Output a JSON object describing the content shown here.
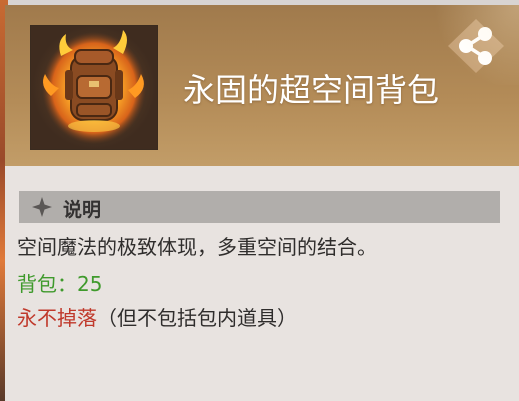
{
  "item": {
    "name": "永固的超空间背包",
    "icon": "backpack-icon"
  },
  "share": {
    "icon": "share-icon"
  },
  "section": {
    "icon": "diamond-star-icon",
    "title": "说明"
  },
  "description": {
    "main": "空间魔法的极致体现，多重空间的结合。",
    "capacity": "背包：25",
    "no_drop": "永不掉落",
    "no_drop_note": "（但不包括包内道具）"
  },
  "colors": {
    "capacity": "#3f9a2c",
    "no_drop": "#c0392b",
    "header": "#b48c58",
    "body": "#e8e3e0",
    "section_bar": "#b1aeab"
  }
}
